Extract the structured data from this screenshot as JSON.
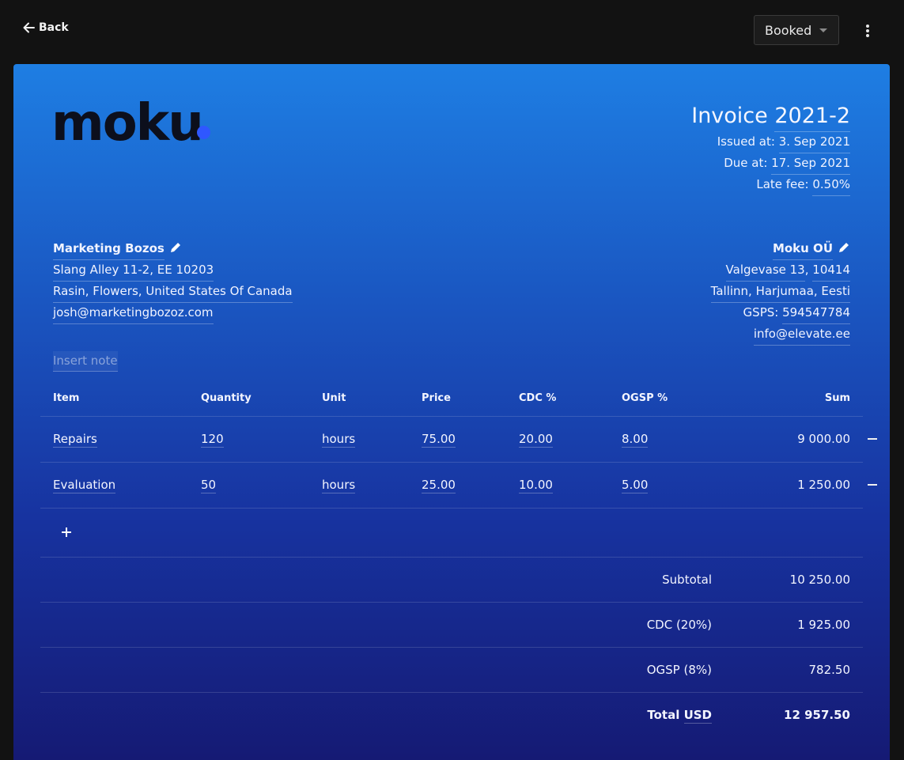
{
  "topbar": {
    "back_label": "Back",
    "status_value": "Booked"
  },
  "invoice": {
    "logo_text": "moku",
    "title_prefix": "Invoice ",
    "number": "2021-2",
    "issued_label": "Issued at: ",
    "issued_value": "3. Sep 2021",
    "due_label": "Due at: ",
    "due_value": "17. Sep 2021",
    "late_fee_label": "Late fee: ",
    "late_fee_value": "0.50%"
  },
  "client": {
    "name": "Marketing Bozos",
    "address_line1": "Slang Alley 11-2, EE 10203",
    "address_line2": "Rasin, Flowers, United States Of Canada",
    "email": "josh@marketingbozoz.com"
  },
  "company": {
    "name": "Moku OÜ",
    "street": "Valgevase 13",
    "sep1": ", ",
    "postal": "10414",
    "city_line": "Tallinn, Harjumaa, Eesti",
    "gsps_label": "GSPS: ",
    "gsps_value": "594547784",
    "email": "info@elevate.ee"
  },
  "note_placeholder": "Insert note",
  "table": {
    "headers": {
      "item": "Item",
      "quantity": "Quantity",
      "unit": "Unit",
      "price": "Price",
      "cdc": "CDC %",
      "ogsp": "OGSP %",
      "sum": "Sum"
    },
    "rows": [
      {
        "item": "Repairs",
        "quantity": "120",
        "unit": "hours",
        "price": "75.00",
        "cdc": "20.00",
        "ogsp": "8.00",
        "sum": "9 000.00"
      },
      {
        "item": "Evaluation",
        "quantity": "50",
        "unit": "hours",
        "price": "25.00",
        "cdc": "10.00",
        "ogsp": "5.00",
        "sum": "1 250.00"
      }
    ]
  },
  "totals": {
    "subtotal_label": "Subtotal",
    "subtotal_value": "10 250.00",
    "cdc_label": "CDC (20%)",
    "cdc_value": "1 925.00",
    "ogsp_label": "OGSP (8%)",
    "ogsp_value": "782.50",
    "total_label": "Total ",
    "currency": "USD",
    "total_value": "12 957.50"
  }
}
